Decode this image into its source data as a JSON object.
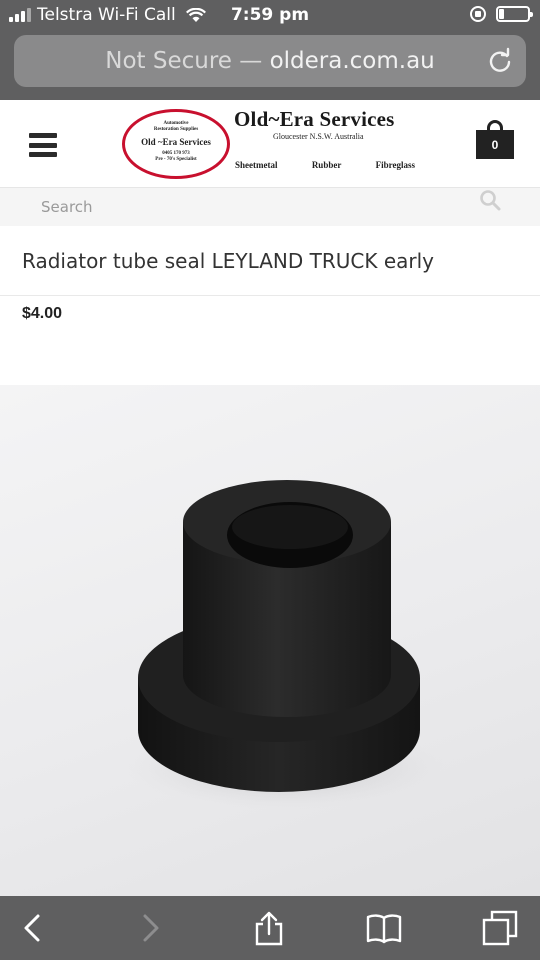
{
  "status_bar": {
    "carrier": "Telstra Wi-Fi Call",
    "time": "7:59 pm",
    "icons": [
      "signal-icon",
      "wifi-icon",
      "rotation-lock-icon",
      "battery-icon"
    ]
  },
  "browser": {
    "url_security": "Not Secure —",
    "url_domain": "oldera.com.au",
    "reload_icon": "reload-icon"
  },
  "site": {
    "logo": {
      "line1": "Automotive",
      "line2": "Restoration Supplies",
      "name": "Old ~Era Services",
      "phone": "0405 170 973",
      "tagline": "Pre - 70's Specialist"
    },
    "brand_title": "Old~Era Services",
    "brand_location": "Gloucester N.S.W. Australia",
    "nav": [
      "Sheetmetal",
      "Rubber",
      "Fibreglass"
    ],
    "cart_count": "0"
  },
  "search": {
    "placeholder": "Search"
  },
  "product": {
    "title": "Radiator tube seal LEYLAND TRUCK early",
    "price": "$4.00"
  },
  "toolbar": {
    "icons": [
      "back-icon",
      "forward-icon",
      "share-icon",
      "bookmarks-icon",
      "tabs-icon"
    ]
  },
  "colors": {
    "chrome": "#5f5f60",
    "url_bar": "#8a8a8b",
    "logo_red": "#c8102e",
    "rubber": "#1e1e1e"
  }
}
